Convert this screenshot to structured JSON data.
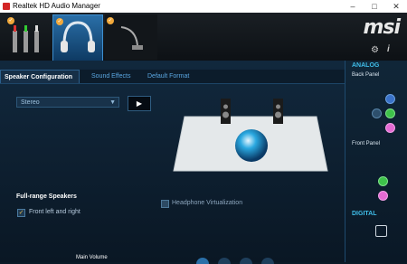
{
  "window": {
    "title": "Realtek HD Audio Manager",
    "min": "–",
    "max": "□",
    "close": "✕"
  },
  "brand": "msi",
  "tabs": [
    {
      "label": "Speaker Configuration"
    },
    {
      "label": "Sound Effects"
    },
    {
      "label": "Default Format"
    }
  ],
  "config": {
    "selected": "Stereo",
    "play_icon": "▶"
  },
  "speakers": {
    "fullrange_title": "Full-range Speakers",
    "fullrange_option": "Front left and right",
    "headphone_virtualization": "Headphone Virtualization",
    "main_volume": "Main Volume"
  },
  "side": {
    "analog": "ANALOG",
    "back_panel": "Back Panel",
    "front_panel": "Front Panel",
    "digital": "DIGITAL"
  },
  "colors": {
    "accent": "#3fbde8",
    "jack_green": "#3ec24a",
    "jack_pink": "#e46bd3",
    "jack_blue": "#3a72c8"
  }
}
